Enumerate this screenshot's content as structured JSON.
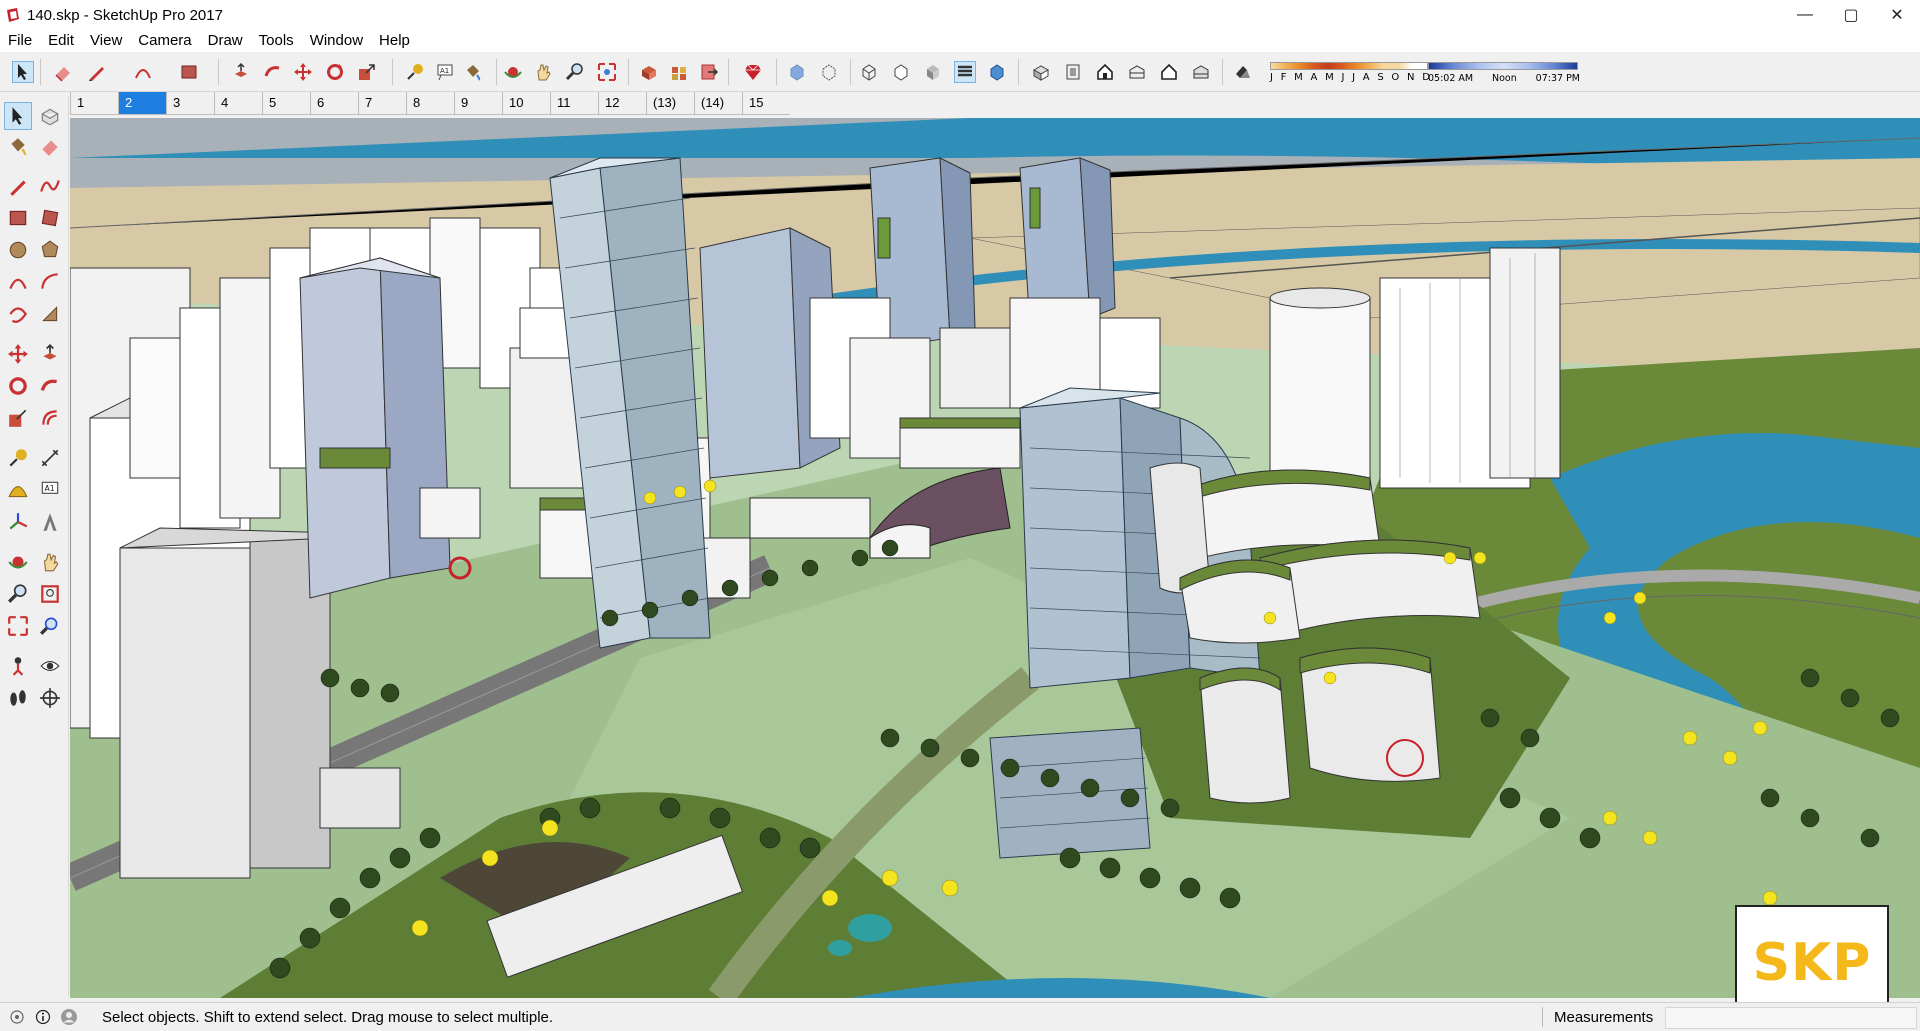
{
  "window": {
    "title": "140.skp - SketchUp Pro 2017",
    "app_icon": "sketchup-icon",
    "controls": {
      "minimize": "—",
      "maximize": "▢",
      "close": "✕"
    }
  },
  "menu": [
    "File",
    "Edit",
    "View",
    "Camera",
    "Draw",
    "Tools",
    "Window",
    "Help"
  ],
  "toolbar": {
    "icons": [
      "select-icon",
      "eraser-icon",
      "pencil-icon",
      "arc-icon",
      "rectangle-icon",
      "push-pull-icon",
      "follow-me-icon",
      "move-icon",
      "rotate-icon",
      "scale-icon",
      "tape-measure-icon",
      "text-icon",
      "paint-bucket-icon",
      "orbit-icon",
      "pan-icon",
      "zoom-icon",
      "zoom-extents-icon",
      "3d-warehouse-icon",
      "extension-warehouse-icon",
      "send-to-layout-icon",
      "ruby-icon",
      "xray-icon",
      "back-edges-icon",
      "wireframe-icon",
      "hidden-line-icon",
      "shaded-icon",
      "shaded-textures-icon",
      "monochrome-icon",
      "iso-view-icon",
      "top-view-icon",
      "front-view-icon",
      "right-view-icon",
      "back-view-icon",
      "left-view-icon",
      "shadows-icon"
    ],
    "shadow_months": [
      "J",
      "F",
      "M",
      "A",
      "M",
      "J",
      "J",
      "A",
      "S",
      "O",
      "N",
      "D"
    ],
    "shadow_times": {
      "start": "05:02 AM",
      "mid": "Noon",
      "end": "07:37 PM"
    }
  },
  "scene_tabs": {
    "active_index": 1,
    "items": [
      "1",
      "2",
      "3",
      "4",
      "5",
      "6",
      "7",
      "8",
      "9",
      "10",
      "11",
      "12",
      "(13)",
      "(14)",
      "15"
    ]
  },
  "left_toolbar": [
    "select-icon",
    "make-component-icon",
    "paint-bucket-icon",
    "eraser-icon",
    "line-icon",
    "freehand-icon",
    "rectangle-icon",
    "rotated-rectangle-icon",
    "circle-icon",
    "polygon-icon",
    "arc-icon",
    "two-point-arc-icon",
    "three-point-arc-icon",
    "pie-icon",
    "move-icon",
    "push-pull-icon",
    "rotate-icon",
    "follow-me-icon",
    "scale-icon",
    "offset-icon",
    "tape-measure-icon",
    "dimension-icon",
    "protractor-icon",
    "text-icon",
    "axes-icon",
    "3d-text-icon",
    "orbit-icon",
    "pan-icon",
    "zoom-icon",
    "zoom-window-icon",
    "zoom-extents-icon",
    "previous-view-icon",
    "position-camera-icon",
    "look-around-icon",
    "walk-icon",
    "section-plane-icon"
  ],
  "status": {
    "hint": "Select objects. Shift to extend select. Drag mouse to select multiple.",
    "measurements_label": "Measurements",
    "measurements_value": ""
  },
  "badge": {
    "text": "SKP"
  },
  "colors": {
    "accent": "#1f7fe0",
    "ground": "#bcd6b4",
    "water": "#2f8fb8",
    "grass": "#6a8a3a",
    "sand": "#d7c9a6",
    "badge_yellow": "#f4b81a"
  }
}
